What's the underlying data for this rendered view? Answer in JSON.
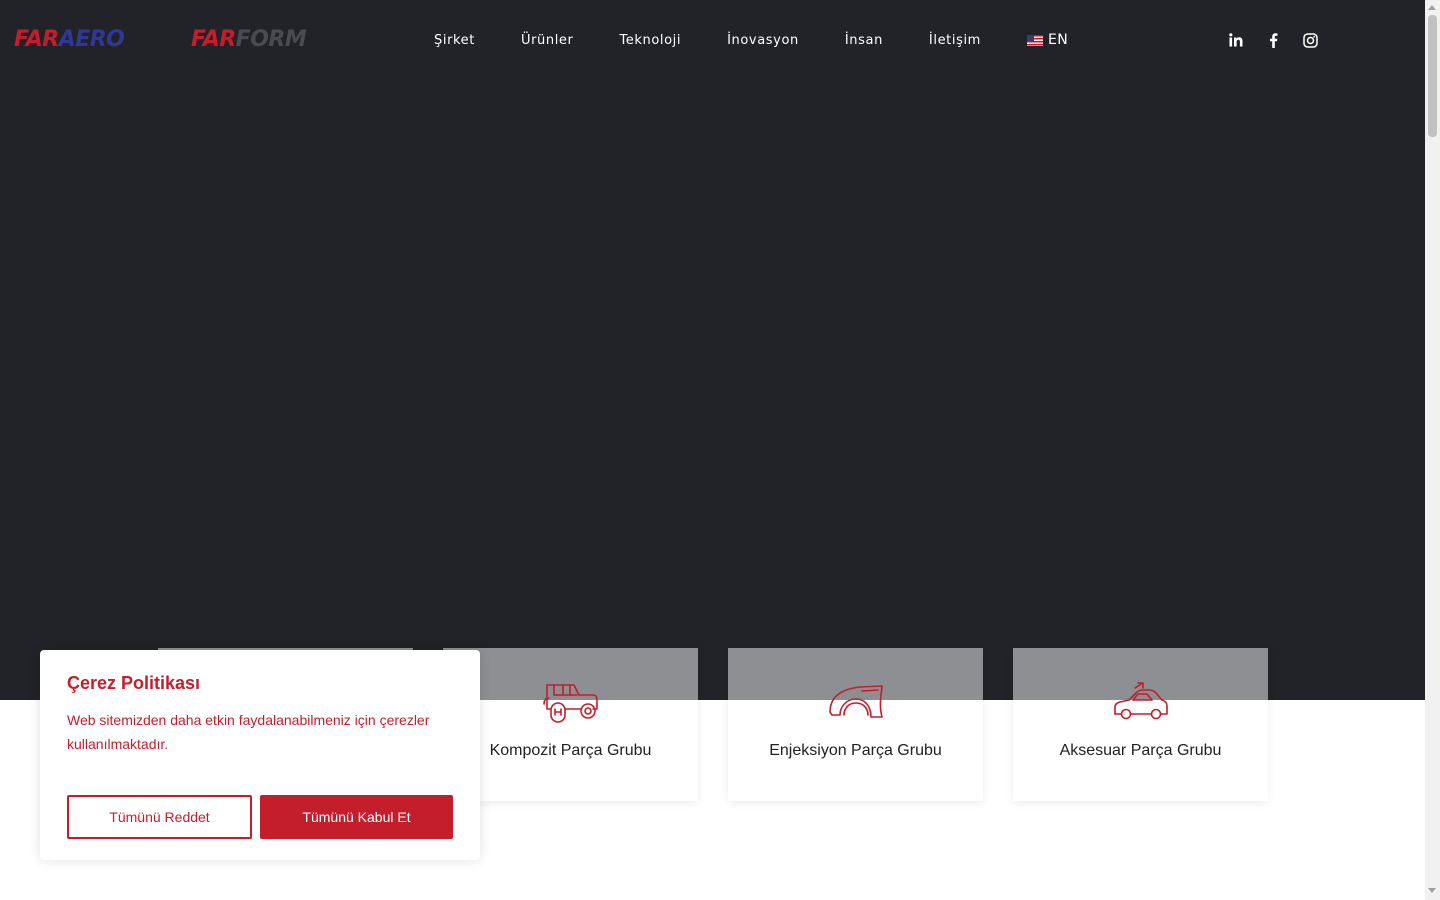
{
  "brand": {
    "logo1_far": "FAR",
    "logo1_aero": "AERO",
    "logo2_far": "FAR",
    "logo2_form": "FORM"
  },
  "nav": {
    "items": [
      {
        "label": "Şirket"
      },
      {
        "label": "Ürünler"
      },
      {
        "label": "Teknoloji"
      },
      {
        "label": "İnovasyon"
      },
      {
        "label": "İnsan"
      },
      {
        "label": "İletişim"
      }
    ],
    "language": "EN"
  },
  "social": {
    "icons": [
      "linkedin-icon",
      "facebook-icon",
      "instagram-icon"
    ]
  },
  "cards": [
    {
      "label": "Kompozit Parça Grubu",
      "icon": "jeep-icon"
    },
    {
      "label": "Enjeksiyon Parça Grubu",
      "icon": "fender-icon"
    },
    {
      "label": "Aksesuar Parça Grubu",
      "icon": "car-accessory-icon"
    }
  ],
  "cookie": {
    "title": "Çerez Politikası",
    "text": "Web sitemizden daha etkin faydalanabilmeniz için çerezler kullanılmaktadır.",
    "reject_label": "Tümünü Reddet",
    "accept_label": "Tümünü Kabul Et"
  },
  "colors": {
    "accent": "#c41e2c",
    "aero_blue": "#2f3896",
    "hero_bg": "#222328",
    "card_top": "#8e8f93"
  }
}
